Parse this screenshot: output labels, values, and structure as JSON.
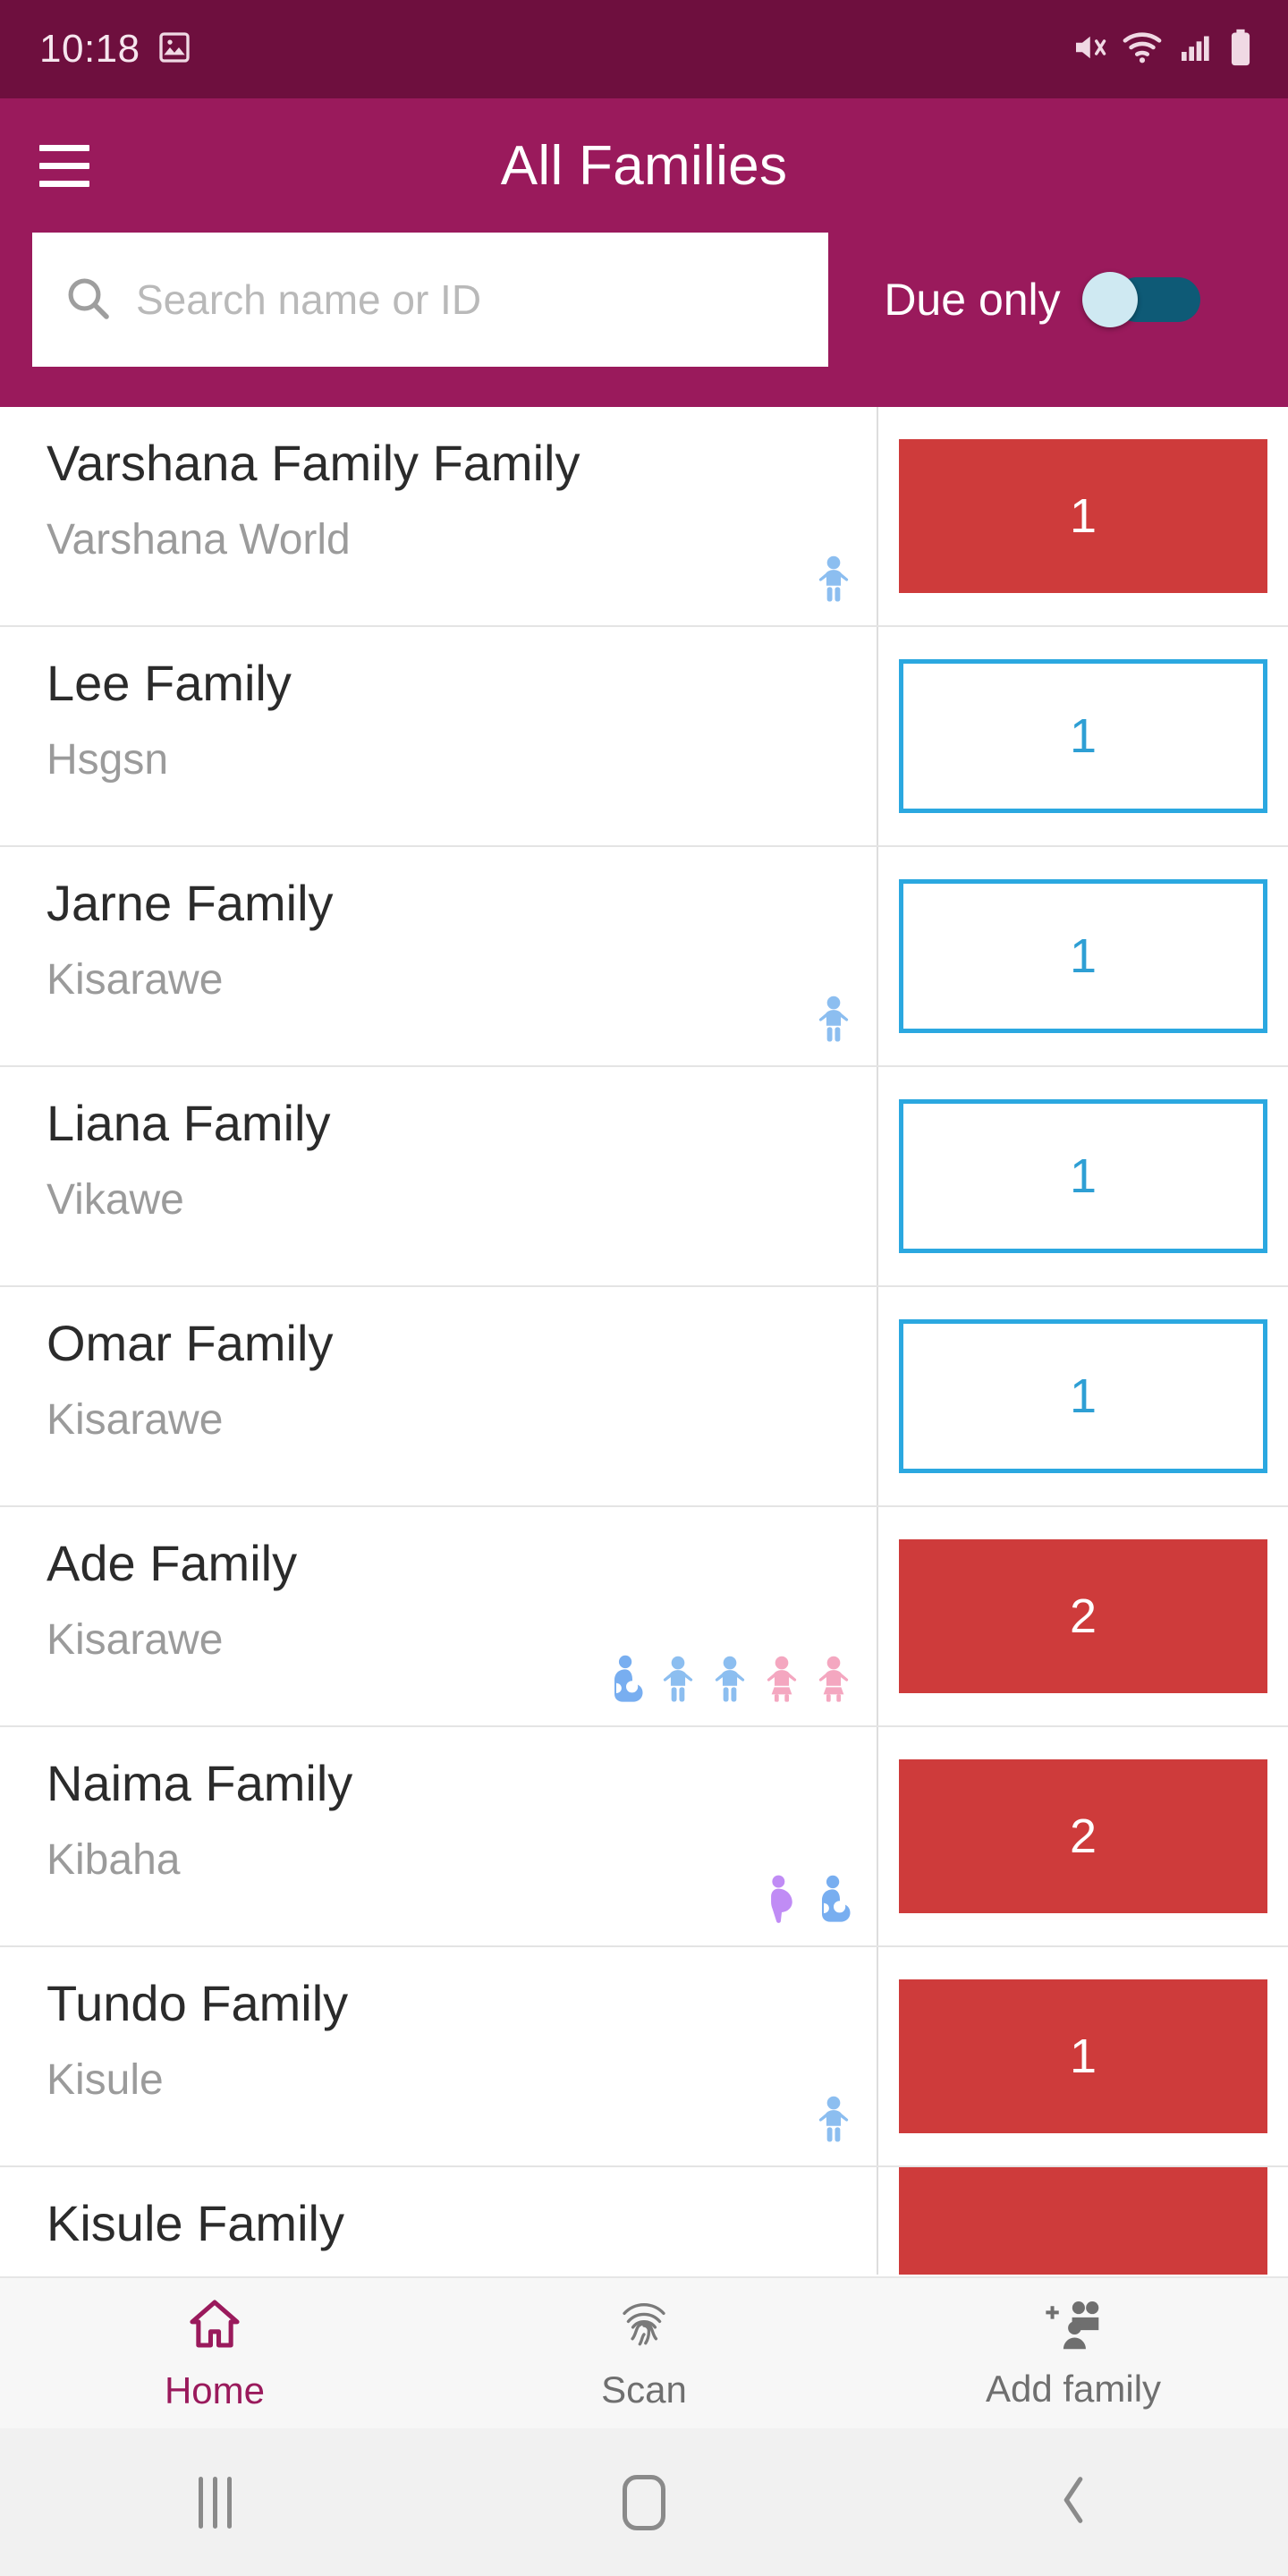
{
  "statusbar": {
    "time": "10:18",
    "icons": [
      "image-icon",
      "mute-icon",
      "wifi-icon",
      "signal-icon",
      "battery-icon"
    ]
  },
  "appbar": {
    "title": "All Families",
    "menu_icon": "hamburger-menu-icon"
  },
  "search": {
    "placeholder": "Search name or ID",
    "value": "",
    "icon": "search-icon"
  },
  "filter": {
    "label": "Due only",
    "enabled": false
  },
  "colors": {
    "statusbar": "#6E0F3E",
    "appbar": "#9A1A5C",
    "badge_due": "#CE3B3B",
    "badge_ok_border": "#2BA8E0",
    "badge_ok_text": "#2E9FD4",
    "toggle_track": "#0E5A76",
    "toggle_thumb": "#CFE9F2",
    "accent": "#9A1A5C",
    "icon_boy": "#8CBEF0",
    "icon_girl": "#F4A7C0",
    "icon_pregnant": "#C08CF5",
    "icon_mother": "#78AEF0"
  },
  "families": [
    {
      "name": "Varshana Family Family",
      "place": "Varshana World",
      "count": "1",
      "status": "due",
      "members": [
        "boy"
      ]
    },
    {
      "name": "Lee Family",
      "place": "Hsgsn",
      "count": "1",
      "status": "ok",
      "members": []
    },
    {
      "name": "Jarne Family",
      "place": "Kisarawe",
      "count": "1",
      "status": "ok",
      "members": [
        "boy"
      ]
    },
    {
      "name": "Liana Family",
      "place": "Vikawe",
      "count": "1",
      "status": "ok",
      "members": []
    },
    {
      "name": "Omar Family",
      "place": "Kisarawe",
      "count": "1",
      "status": "ok",
      "members": []
    },
    {
      "name": "Ade Family",
      "place": "Kisarawe",
      "count": "2",
      "status": "due",
      "members": [
        "mother",
        "boy",
        "boy",
        "girl",
        "girl"
      ]
    },
    {
      "name": "Naima Family",
      "place": "Kibaha",
      "count": "2",
      "status": "due",
      "members": [
        "pregnant",
        "mother"
      ]
    },
    {
      "name": "Tundo Family",
      "place": "Kisule",
      "count": "1",
      "status": "due",
      "members": [
        "boy"
      ]
    },
    {
      "name": "Kisule Family",
      "place": "",
      "count": "",
      "status": "due",
      "members": []
    }
  ],
  "bottomnav": {
    "items": [
      {
        "label": "Home",
        "icon": "home-icon",
        "active": true
      },
      {
        "label": "Scan",
        "icon": "fingerprint-icon",
        "active": false
      },
      {
        "label": "Add family",
        "icon": "add-family-icon",
        "active": false
      }
    ]
  },
  "androidnav": {
    "items": [
      "recents-icon",
      "home-icon",
      "back-icon"
    ]
  }
}
